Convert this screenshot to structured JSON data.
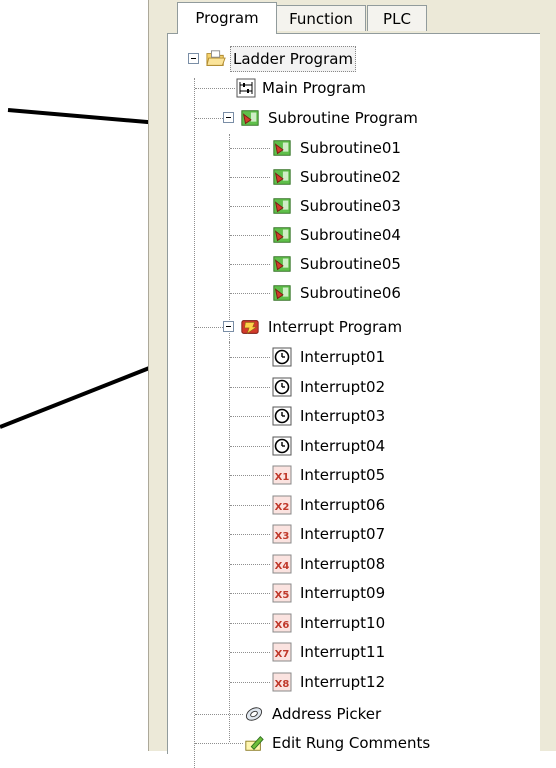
{
  "tabs": [
    {
      "label": "Program",
      "active": true
    },
    {
      "label": "Function",
      "active": false
    },
    {
      "label": "PLC",
      "active": false
    }
  ],
  "tree": {
    "root": {
      "label": "Ladder Program",
      "icon": "folder-open-icon"
    },
    "main_program": {
      "label": "Main Program",
      "icon": "main-program-icon"
    },
    "subroutine_group": {
      "label": "Subroutine Program",
      "icon": "subroutine-icon"
    },
    "subroutines": [
      {
        "label": "Subroutine01"
      },
      {
        "label": "Subroutine02"
      },
      {
        "label": "Subroutine03"
      },
      {
        "label": "Subroutine04"
      },
      {
        "label": "Subroutine05"
      },
      {
        "label": "Subroutine06"
      }
    ],
    "interrupt_group": {
      "label": "Interrupt Program",
      "icon": "interrupt-icon"
    },
    "interrupts": [
      {
        "label": "Interrupt01",
        "icon": "clock-icon",
        "badge": ""
      },
      {
        "label": "Interrupt02",
        "icon": "clock-icon",
        "badge": ""
      },
      {
        "label": "Interrupt03",
        "icon": "clock-icon",
        "badge": ""
      },
      {
        "label": "Interrupt04",
        "icon": "clock-icon",
        "badge": ""
      },
      {
        "label": "Interrupt05",
        "icon": "x-input-icon",
        "badge": "X1"
      },
      {
        "label": "Interrupt06",
        "icon": "x-input-icon",
        "badge": "X2"
      },
      {
        "label": "Interrupt07",
        "icon": "x-input-icon",
        "badge": "X3"
      },
      {
        "label": "Interrupt08",
        "icon": "x-input-icon",
        "badge": "X4"
      },
      {
        "label": "Interrupt09",
        "icon": "x-input-icon",
        "badge": "X5"
      },
      {
        "label": "Interrupt10",
        "icon": "x-input-icon",
        "badge": "X6"
      },
      {
        "label": "Interrupt11",
        "icon": "x-input-icon",
        "badge": "X7"
      },
      {
        "label": "Interrupt12",
        "icon": "x-input-icon",
        "badge": "X8"
      }
    ],
    "address_picker": {
      "label": "Address Picker",
      "icon": "address-picker-icon"
    },
    "edit_rung_comments": {
      "label": "Edit Rung Comments",
      "icon": "edit-comment-icon"
    }
  },
  "colors": {
    "panel_bg": "#ece9d8",
    "tree_bg": "#ffffff",
    "arrow": "#000000",
    "badge_red": "#c0392b"
  }
}
